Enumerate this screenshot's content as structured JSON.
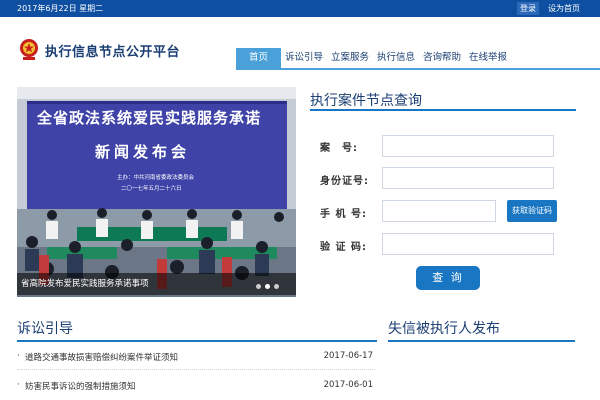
{
  "topbar": {
    "date": "2017年6月22日 星期二",
    "login_label": "登录",
    "home_label": "设为首页"
  },
  "header": {
    "title": "执行信息节点公开平台",
    "logo_icon": "court-emblem-icon"
  },
  "nav": {
    "items": [
      {
        "label": "首页",
        "active": true
      },
      {
        "label": "诉讼引导",
        "active": false
      },
      {
        "label": "立案服务",
        "active": false
      },
      {
        "label": "执行信息",
        "active": false
      },
      {
        "label": "咨询帮助",
        "active": false
      },
      {
        "label": "在线举报",
        "active": false
      }
    ]
  },
  "banner": {
    "slogan": "全省政法系统爱民实践服务承诺",
    "subtitle": "新闻发布会",
    "sponsor": "主办：中共河南省委政法委员会",
    "event_date": "二〇一七年五月二十六日",
    "caption": "省高院发布爱民实践服务承诺事项",
    "slides": 3,
    "active_slide": 1
  },
  "query": {
    "title": "执行案件节点查询",
    "labels": {
      "case_no": "案　号:",
      "id_no": "身份证号:",
      "phone": "手 机 号:",
      "code": "验 证 码:"
    },
    "get_code_label": "获取验证码",
    "submit_label": "查 询"
  },
  "litigation": {
    "title": "诉讼引导",
    "items": [
      {
        "text": "道路交通事故损害赔偿纠纷案件举证须知",
        "date": "2017-06-17"
      },
      {
        "text": "妨害民事诉讼的强制措施须知",
        "date": "2017-06-01"
      }
    ]
  },
  "dishonest": {
    "title": "失信被执行人发布"
  },
  "colors": {
    "brand_dark": "#0e4fa1",
    "accent": "#1976c2",
    "nav_active": "#4aa0d8"
  }
}
